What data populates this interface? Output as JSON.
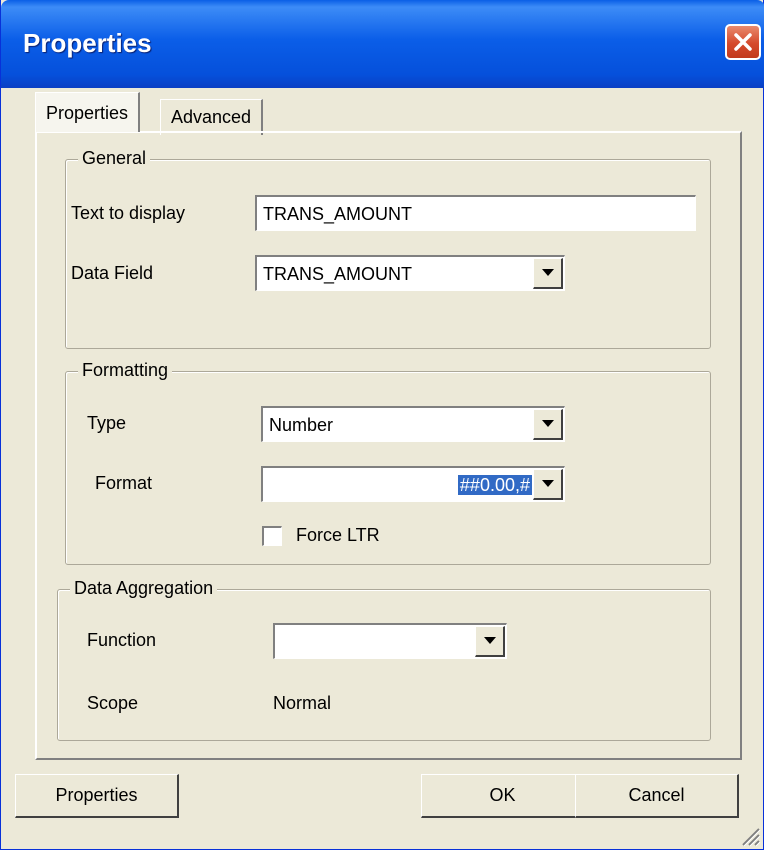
{
  "window": {
    "title": "Properties",
    "close_icon": "close-icon"
  },
  "tabs": [
    {
      "label": "Properties",
      "active": true
    },
    {
      "label": "Advanced",
      "active": false
    }
  ],
  "general": {
    "legend": "General",
    "text_to_display_label": "Text to display",
    "text_to_display_value": "TRANS_AMOUNT",
    "data_field_label": "Data Field",
    "data_field_value": "TRANS_AMOUNT"
  },
  "formatting": {
    "legend": "Formatting",
    "type_label": "Type",
    "type_value": "Number",
    "format_label": "Format",
    "format_value": "##0.00,#",
    "force_ltr_label": "Force LTR",
    "force_ltr_checked": false
  },
  "aggregation": {
    "legend": "Data Aggregation",
    "function_label": "Function",
    "function_value": "",
    "scope_label": "Scope",
    "scope_value": "Normal"
  },
  "buttons": {
    "properties": "Properties",
    "ok": "OK",
    "cancel": "Cancel"
  },
  "colors": {
    "title_bar": "#0b5ee8",
    "close_button": "#d5492b",
    "dialog_bg": "#ece9d8",
    "selection": "#316ac5"
  }
}
